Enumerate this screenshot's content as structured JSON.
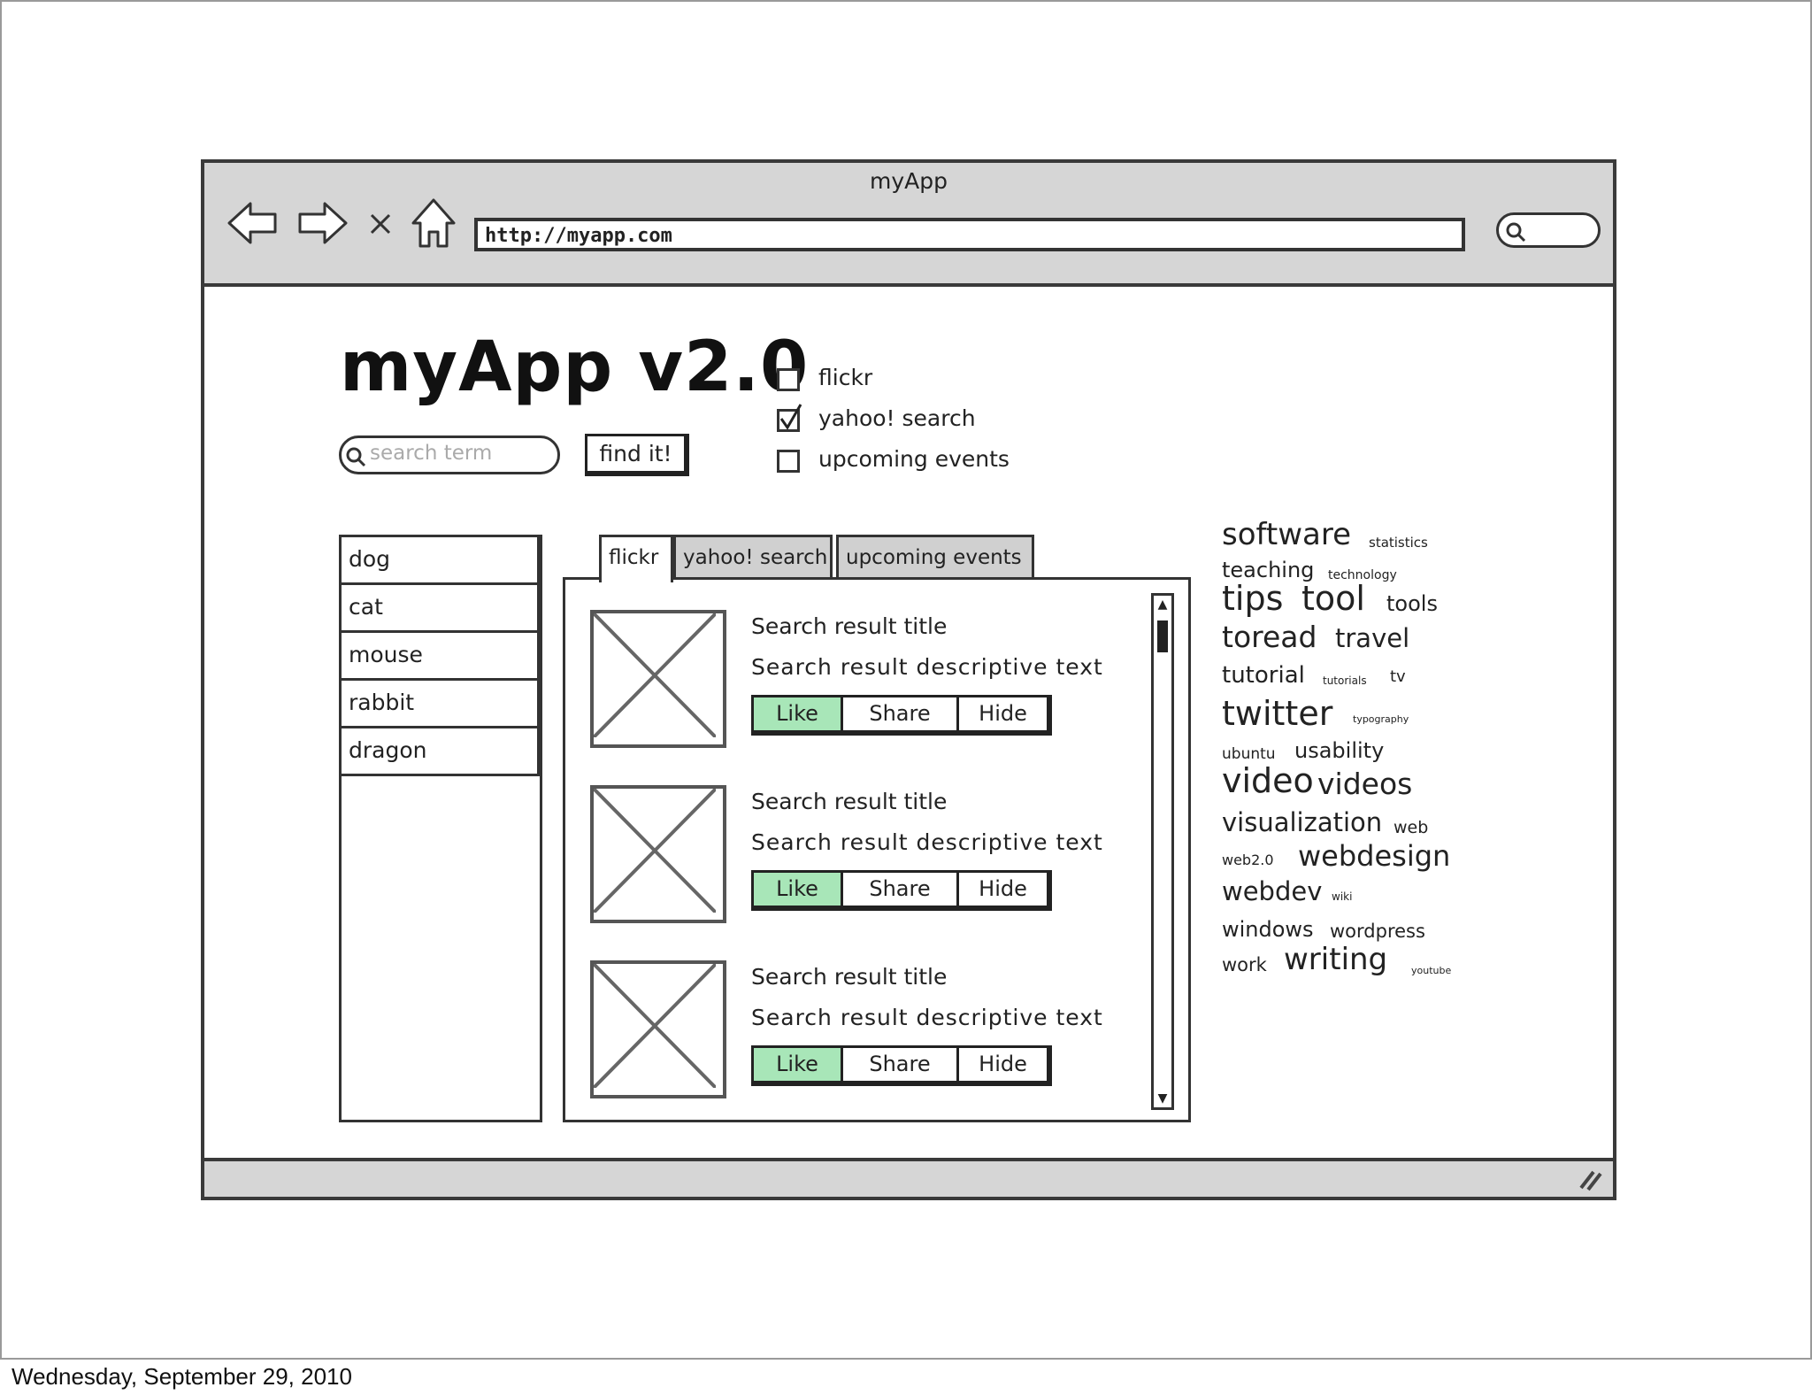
{
  "window": {
    "title": "myApp",
    "url": "http://myapp.com"
  },
  "app": {
    "title": "myApp v2.0",
    "search_placeholder": "search term",
    "find_button": "find it!"
  },
  "sources": [
    {
      "label": "flickr",
      "checked": false
    },
    {
      "label": "yahoo! search",
      "checked": true
    },
    {
      "label": "upcoming events",
      "checked": false
    }
  ],
  "list_items": [
    "dog",
    "cat",
    "mouse",
    "rabbit",
    "dragon"
  ],
  "tabs": [
    {
      "label": "flickr",
      "active": true
    },
    {
      "label": "yahoo! search",
      "active": false
    },
    {
      "label": "upcoming events",
      "active": false
    }
  ],
  "results": [
    {
      "title": "Search result title",
      "description": "Search result descriptive text"
    },
    {
      "title": "Search result title",
      "description": "Search result descriptive text"
    },
    {
      "title": "Search result title",
      "description": "Search result descriptive text"
    }
  ],
  "result_buttons": {
    "like": "Like",
    "share": "Share",
    "hide": "Hide"
  },
  "tag_cloud": [
    "software",
    "statistics",
    "teaching",
    "technology",
    "tips",
    "tool",
    "tools",
    "toread",
    "travel",
    "tutorial",
    "tutorials",
    "tv",
    "twitter",
    "typography",
    "ubuntu",
    "usability",
    "video",
    "videos",
    "visualization",
    "web",
    "web2.0",
    "webdesign",
    "webdev",
    "wiki",
    "windows",
    "wordpress",
    "work",
    "writing",
    "youtube"
  ],
  "footer_date": "Wednesday, September 29, 2010",
  "colors": {
    "chrome_gray": "#d6d6d6",
    "like_green": "#a8e6b8",
    "border": "#333333"
  }
}
